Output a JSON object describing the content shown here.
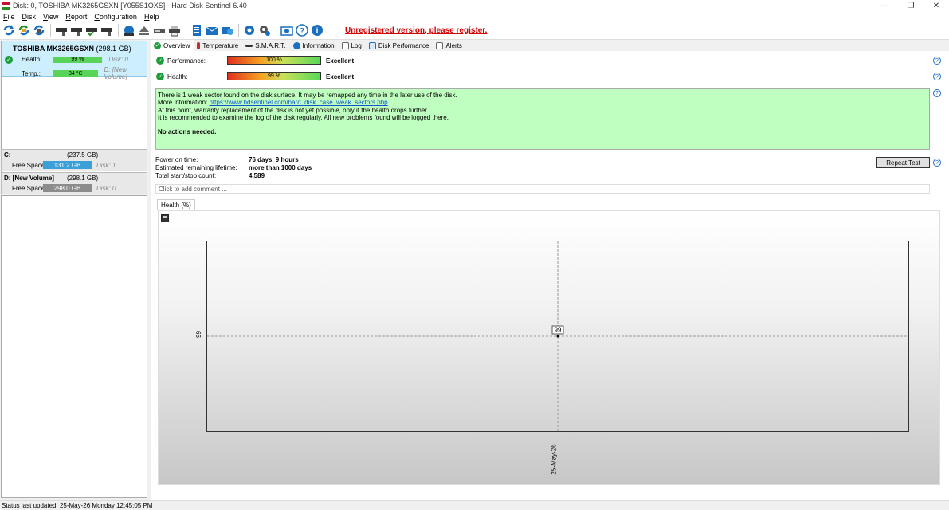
{
  "window": {
    "title": "Disk: 0, TOSHIBA MK3265GSXN [Y055S1OXS]  -  Hard Disk Sentinel 6.40",
    "minimize": "—",
    "maximize": "❐",
    "close": "✕"
  },
  "menu": [
    {
      "first": "F",
      "rest": "ile"
    },
    {
      "first": "D",
      "rest": "isk"
    },
    {
      "first": "V",
      "rest": "iew"
    },
    {
      "first": "R",
      "rest": "eport"
    },
    {
      "first": "C",
      "rest": "onfiguration"
    },
    {
      "first": "H",
      "rest": "elp"
    }
  ],
  "toolbar": {
    "warning": "Unregistered version, please register."
  },
  "disk": {
    "name": "TOSHIBA MK3265GSXN",
    "size": "(298.1 GB)",
    "health_label": "Health:",
    "health_value": "99 %",
    "disk_index": "Disk: 0",
    "temp_label": "Temp.:",
    "temp_value": "34 °C",
    "volume_ref": "D: [New Volume]"
  },
  "volumes": [
    {
      "title": "C:",
      "size": "(237.5 GB)",
      "free_label": "Free Space",
      "free_value": "131.2 GB",
      "disk": "Disk: 1",
      "bar_color": "#3ca0d8"
    },
    {
      "title": "D: [New Volume]",
      "size": "(298.1 GB)",
      "free_label": "Free Space",
      "free_value": "298.0 GB",
      "disk": "Disk: 0",
      "bar_color": "#8c8c8c"
    }
  ],
  "tabs": [
    "Overview",
    "Temperature",
    "S.M.A.R.T.",
    "Information",
    "Log",
    "Disk Performance",
    "Alerts"
  ],
  "overview": {
    "performance_label": "Performance:",
    "performance_value": "100 %",
    "performance_rating": "Excellent",
    "health_label": "Health:",
    "health_value": "99 %",
    "health_rating": "Excellent",
    "msg_line1": "There is 1 weak sector found on the disk surface. It may be remapped any time in the later use of the disk.",
    "msg_more_prefix": "More information: ",
    "msg_link": "https://www.hdsentinel.com/hard_disk_case_weak_sectors.php",
    "msg_line3": "At this point, warranty replacement of the disk is not yet possible, only if the health drops further.",
    "msg_line4": "It is recommended to examine the log of the disk regularly. All new problems found will be logged there.",
    "msg_action": "No actions needed.",
    "power_on_label": "Power on time:",
    "power_on_value": "76 days, 9 hours",
    "lifetime_label": "Estimated remaining lifetime:",
    "lifetime_value": "more than 1000 days",
    "startstop_label": "Total start/stop count:",
    "startstop_value": "4,589",
    "repeat_test": "Repeat Test",
    "comment_placeholder": "Click to add comment ...",
    "chart_tab": "Health (%)"
  },
  "chart_data": {
    "type": "line",
    "x": [
      "25-May-26"
    ],
    "series": [
      {
        "values": [
          99
        ]
      }
    ],
    "ytick": "99",
    "data_label": "99"
  },
  "status": "Status last updated: 25-May-26 Monday 12:45:05 PM"
}
